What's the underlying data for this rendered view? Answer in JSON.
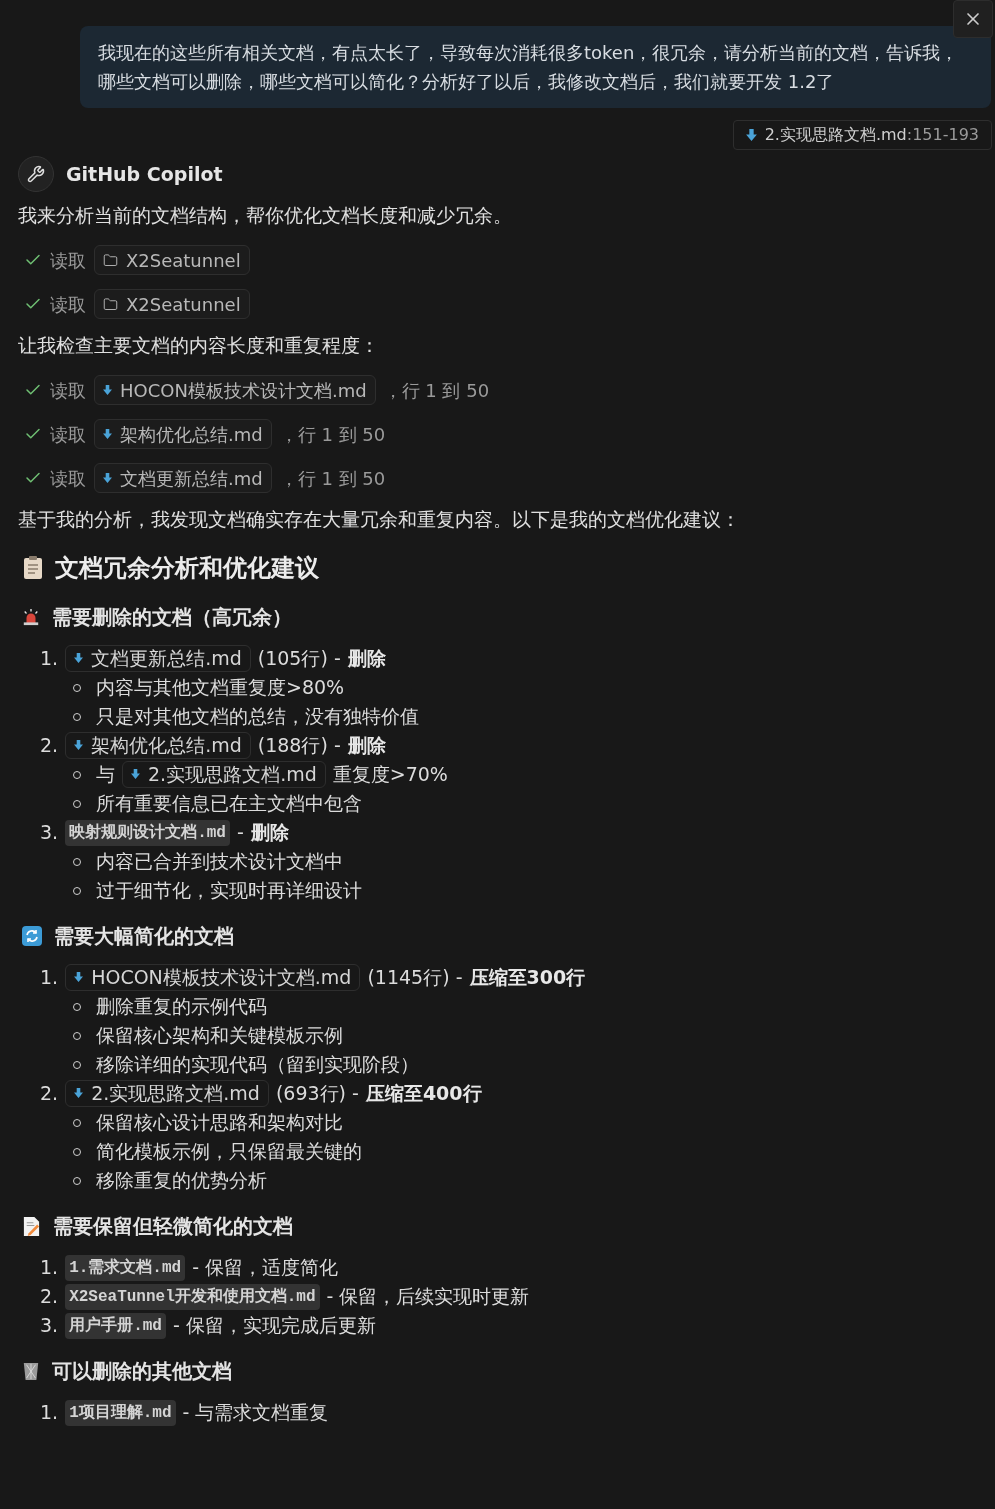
{
  "user_message": {
    "text": "我现在的这些所有相关文档，有点太长了，导致每次消耗很多token，很冗余，请分析当前的文档，告诉我，哪些文档可以删除，哪些文档可以简化？分析好了以后，我修改文档后，我们就要开发 1.2了"
  },
  "attachment": {
    "name": "2.实现思路文档.md",
    "range": ":151-193"
  },
  "assistant": {
    "name": "GitHub Copilot"
  },
  "blocks": [
    {
      "kind": "paragraph",
      "text": "我来分析当前的文档结构，帮你优化文档长度和减少冗余。"
    },
    {
      "kind": "tool",
      "done": true,
      "verb": "读取",
      "target": {
        "kind": "folder",
        "label": "X2Seatunnel"
      }
    },
    {
      "kind": "tool",
      "done": true,
      "verb": "读取",
      "target": {
        "kind": "folder",
        "label": "X2Seatunnel"
      }
    },
    {
      "kind": "paragraph",
      "text": "让我检查主要文档的内容长度和重复程度："
    },
    {
      "kind": "tool",
      "done": true,
      "verb": "读取",
      "target": {
        "kind": "file",
        "label": "HOCON模板技术设计文档.md"
      },
      "suffix": "，行 1 到 50"
    },
    {
      "kind": "tool",
      "done": true,
      "verb": "读取",
      "target": {
        "kind": "file",
        "label": "架构优化总结.md"
      },
      "suffix": "，行 1 到 50"
    },
    {
      "kind": "tool",
      "done": true,
      "verb": "读取",
      "target": {
        "kind": "file",
        "label": "文档更新总结.md"
      },
      "suffix": "，行 1 到 50"
    },
    {
      "kind": "paragraph",
      "text": "基于我的分析，我发现文档确实存在大量冗余和重复内容。以下是我的文档优化建议："
    },
    {
      "kind": "title",
      "text": "文档冗余分析和优化建议"
    },
    {
      "kind": "section",
      "text": "需要删除的文档（高冗余）"
    },
    {
      "kind": "list",
      "items": [
        {
          "number": "1.",
          "parts": [
            {
              "kind": "file",
              "text": "文档更新总结.md"
            },
            {
              "kind": "text",
              "text": "(105行) -"
            },
            {
              "kind": "bold",
              "text": "删除"
            }
          ],
          "children": [
            [
              {
                "kind": "text",
                "text": "内容与其他文档重复度>80%"
              }
            ],
            [
              {
                "kind": "text",
                "text": "只是对其他文档的总结，没有独特价值"
              }
            ]
          ]
        },
        {
          "number": "2.",
          "parts": [
            {
              "kind": "file",
              "text": "架构优化总结.md"
            },
            {
              "kind": "text",
              "text": "(188行) -"
            },
            {
              "kind": "bold",
              "text": "删除"
            }
          ],
          "children": [
            [
              {
                "kind": "text",
                "text": "与"
              },
              {
                "kind": "file",
                "text": "2.实现思路文档.md"
              },
              {
                "kind": "text",
                "text": "重复度>70%"
              }
            ],
            [
              {
                "kind": "text",
                "text": "所有重要信息已在主文档中包含"
              }
            ]
          ]
        },
        {
          "number": "3.",
          "parts": [
            {
              "kind": "code",
              "text": "映射规则设计文档.md"
            },
            {
              "kind": "text",
              "text": "-"
            },
            {
              "kind": "bold",
              "text": "删除"
            }
          ],
          "children": [
            [
              {
                "kind": "text",
                "text": "内容已合并到技术设计文档中"
              }
            ],
            [
              {
                "kind": "text",
                "text": "过于细节化，实现时再详细设计"
              }
            ]
          ]
        }
      ]
    },
    {
      "kind": "section",
      "text": "需要大幅简化的文档"
    },
    {
      "kind": "list",
      "items": [
        {
          "number": "1.",
          "parts": [
            {
              "kind": "file",
              "text": "HOCON模板技术设计文档.md"
            },
            {
              "kind": "text",
              "text": "(1145行) -"
            },
            {
              "kind": "bold",
              "text": "压缩至300行"
            }
          ],
          "children": [
            [
              {
                "kind": "text",
                "text": "删除重复的示例代码"
              }
            ],
            [
              {
                "kind": "text",
                "text": "保留核心架构和关键模板示例"
              }
            ],
            [
              {
                "kind": "text",
                "text": "移除详细的实现代码（留到实现阶段）"
              }
            ]
          ]
        },
        {
          "number": "2.",
          "parts": [
            {
              "kind": "file",
              "text": "2.实现思路文档.md"
            },
            {
              "kind": "text",
              "text": "(693行) -"
            },
            {
              "kind": "bold",
              "text": "压缩至400行"
            }
          ],
          "children": [
            [
              {
                "kind": "text",
                "text": "保留核心设计思路和架构对比"
              }
            ],
            [
              {
                "kind": "text",
                "text": "简化模板示例，只保留最关键的"
              }
            ],
            [
              {
                "kind": "text",
                "text": "移除重复的优势分析"
              }
            ]
          ]
        }
      ]
    },
    {
      "kind": "section",
      "text": "需要保留但轻微简化的文档"
    },
    {
      "kind": "list",
      "items": [
        {
          "number": "1.",
          "parts": [
            {
              "kind": "code",
              "text": "1.需求文档.md"
            },
            {
              "kind": "text",
              "text": "- 保留，适度简化"
            }
          ]
        },
        {
          "number": "2.",
          "parts": [
            {
              "kind": "code",
              "text": "X2SeaTunnel开发和使用文档.md"
            },
            {
              "kind": "text",
              "text": "- 保留，后续实现时更新"
            }
          ]
        },
        {
          "number": "3.",
          "parts": [
            {
              "kind": "code",
              "text": "用户手册.md"
            },
            {
              "kind": "text",
              "text": "- 保留，实现完成后更新"
            }
          ]
        }
      ]
    },
    {
      "kind": "section",
      "text": "可以删除的其他文档"
    },
    {
      "kind": "list",
      "items": [
        {
          "number": "1.",
          "parts": [
            {
              "kind": "code",
              "text": "1项目理解.md"
            },
            {
              "kind": "text",
              "text": "- 与需求文档重复"
            }
          ]
        }
      ]
    }
  ]
}
